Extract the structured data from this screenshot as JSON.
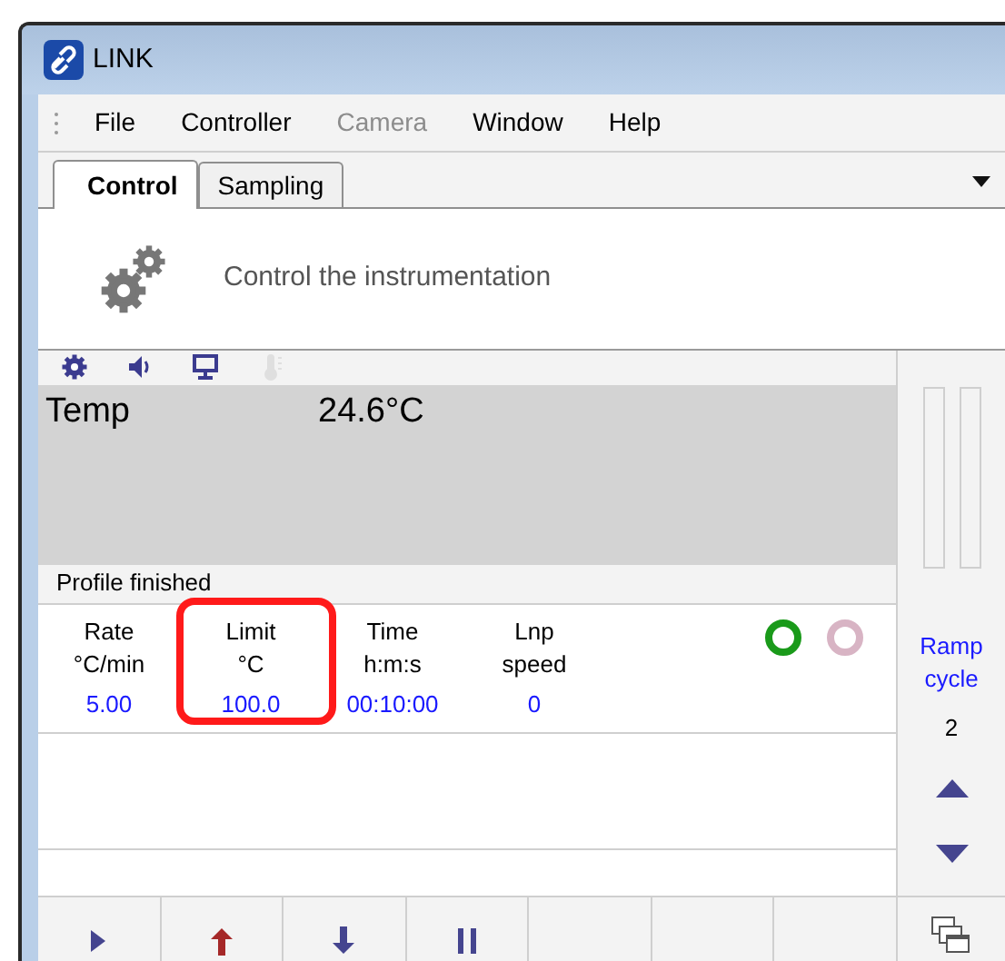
{
  "window": {
    "title": "LINK"
  },
  "menu": [
    {
      "label": "File",
      "disabled": false
    },
    {
      "label": "Controller",
      "disabled": false
    },
    {
      "label": "Camera",
      "disabled": true
    },
    {
      "label": "Window",
      "disabled": false
    },
    {
      "label": "Help",
      "disabled": false
    }
  ],
  "tabs": [
    {
      "label": "Control",
      "selected": true
    },
    {
      "label": "Sampling",
      "selected": false
    }
  ],
  "header": {
    "text": "Control the instrumentation"
  },
  "status_icons": [
    {
      "kind": "gear",
      "disabled": false
    },
    {
      "kind": "speaker",
      "disabled": false
    },
    {
      "kind": "monitor",
      "disabled": false
    },
    {
      "kind": "thermometer",
      "disabled": true
    }
  ],
  "display": {
    "label": "Temp",
    "reading": "24.6°C"
  },
  "status": "Profile finished",
  "columns": [
    {
      "title": "Rate",
      "unit": "°C/min",
      "value": "5.00",
      "highlighted": false
    },
    {
      "title": "Limit",
      "unit": "°C",
      "value": "100.0",
      "highlighted": true
    },
    {
      "title": "Time",
      "unit": "h:m:s",
      "value": "00:10:00",
      "highlighted": false
    },
    {
      "title": "Lnp",
      "unit": "speed",
      "value": "0",
      "highlighted": false
    }
  ],
  "indicators": [
    {
      "color": "#1a9a1a"
    },
    {
      "color": "#d8b4c4"
    }
  ],
  "ramp": {
    "label": "Ramp cycle",
    "value": "2"
  },
  "toolbar": [
    {
      "kind": "play"
    },
    {
      "kind": "up"
    },
    {
      "kind": "down"
    },
    {
      "kind": "pause"
    },
    {
      "kind": "empty"
    },
    {
      "kind": "empty"
    },
    {
      "kind": "empty"
    }
  ]
}
